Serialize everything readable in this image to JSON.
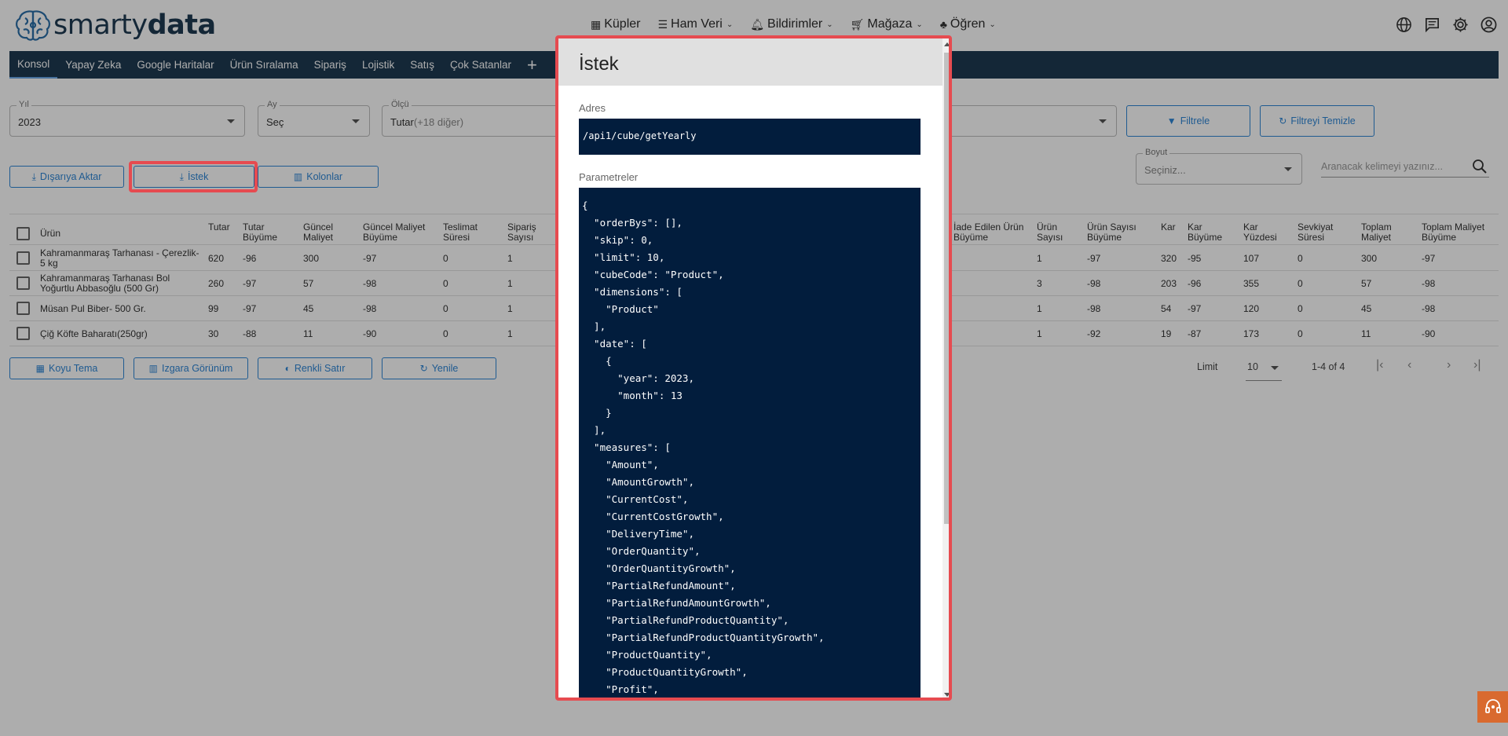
{
  "brand": {
    "name_light": "smarty",
    "name_bold": "data"
  },
  "topnav": [
    {
      "label": "Küpler",
      "icon": "grid-icon",
      "dropdown": false
    },
    {
      "label": "Ham Veri",
      "icon": "list-icon",
      "dropdown": true
    },
    {
      "label": "Bildirimler",
      "icon": "bell-icon",
      "dropdown": true
    },
    {
      "label": "Mağaza",
      "icon": "cart-icon",
      "dropdown": true
    },
    {
      "label": "Öğren",
      "icon": "learn-icon",
      "dropdown": true
    }
  ],
  "tabs": [
    "Konsol",
    "Yapay Zeka",
    "Google Haritalar",
    "Ürün Sıralama",
    "Sipariş",
    "Lojistik",
    "Satış",
    "Çok Satanlar"
  ],
  "filters": {
    "year": {
      "label": "Yıl",
      "value": "2023"
    },
    "month": {
      "label": "Ay",
      "value": "Seç"
    },
    "measure": {
      "label": "Ölçü",
      "value": "Tutar",
      "extra": "(+18 diğer)"
    },
    "filter_button": "Filtrele",
    "clear_button": "Filtreyi Temizle",
    "dimension": {
      "label": "Boyut",
      "placeholder": "Seçiniz..."
    },
    "search_placeholder": "Aranacak kelimeyi yazınız..."
  },
  "actions": {
    "export": "Dışarıya Aktar",
    "request": "İstek",
    "columns": "Kolonlar"
  },
  "table": {
    "left_headers": [
      {
        "l1": "Ürün",
        "l2": ""
      },
      {
        "l1": "Tutar",
        "l2": ""
      },
      {
        "l1": "Tutar",
        "l2": "Büyüme"
      },
      {
        "l1": "Güncel",
        "l2": "Maliyet"
      },
      {
        "l1": "Güncel Maliyet",
        "l2": "Büyüme"
      },
      {
        "l1": "Teslimat",
        "l2": "Süresi"
      },
      {
        "l1": "Sipariş",
        "l2": "Sayısı"
      }
    ],
    "right_headers": [
      {
        "l1": "İade Edilen Ürün",
        "l2": "Büyüme"
      },
      {
        "l1": "Ürün",
        "l2": "Sayısı"
      },
      {
        "l1": "Ürün Sayısı",
        "l2": "Büyüme"
      },
      {
        "l1": "Kar",
        "l2": ""
      },
      {
        "l1": "Kar",
        "l2": "Büyüme"
      },
      {
        "l1": "Kar",
        "l2": "Yüzdesi"
      },
      {
        "l1": "Sevkiyat",
        "l2": "Süresi"
      },
      {
        "l1": "Toplam",
        "l2": "Maliyet"
      },
      {
        "l1": "Toplam Maliyet",
        "l2": "Büyüme"
      }
    ],
    "rows": [
      {
        "product": "Kahramanmaraş Tarhanası - Çerezlik- 5 kg",
        "left": [
          "620",
          "-96",
          "300",
          "-97",
          "0",
          "1"
        ],
        "right": [
          "1",
          "-97",
          "320",
          "-95",
          "107",
          "0",
          "300",
          "-97"
        ]
      },
      {
        "product": "Kahramanmaraş Tarhanası Bol Yoğurtlu Abbasoğlu (500 Gr)",
        "left": [
          "260",
          "-97",
          "57",
          "-98",
          "0",
          "1"
        ],
        "right": [
          "3",
          "-98",
          "203",
          "-96",
          "355",
          "0",
          "57",
          "-98"
        ]
      },
      {
        "product": "Müsan Pul Biber- 500 Gr.",
        "left": [
          "99",
          "-97",
          "45",
          "-98",
          "0",
          "1"
        ],
        "right": [
          "1",
          "-98",
          "54",
          "-97",
          "120",
          "0",
          "45",
          "-98"
        ]
      },
      {
        "product": "Çiğ Köfte Baharatı(250gr)",
        "left": [
          "30",
          "-88",
          "11",
          "-90",
          "0",
          "1"
        ],
        "right": [
          "1",
          "-92",
          "19",
          "-87",
          "173",
          "0",
          "11",
          "-90"
        ]
      }
    ]
  },
  "bottom_buttons": {
    "dark": "Koyu Tema",
    "grid": "Izgara Görünüm",
    "color_row": "Renkli Satır",
    "refresh": "Yenile"
  },
  "pagination": {
    "limit_label": "Limit",
    "limit_value": "10",
    "range": "1-4 of 4"
  },
  "modal": {
    "title": "İstek",
    "address_label": "Adres",
    "address": "/api1/cube/getYearly",
    "params_label": "Parametreler",
    "code": "{\n  \"orderBys\": [],\n  \"skip\": 0,\n  \"limit\": 10,\n  \"cubeCode\": \"Product\",\n  \"dimensions\": [\n    \"Product\"\n  ],\n  \"date\": [\n    {\n      \"year\": 2023,\n      \"month\": 13\n    }\n  ],\n  \"measures\": [\n    \"Amount\",\n    \"AmountGrowth\",\n    \"CurrentCost\",\n    \"CurrentCostGrowth\",\n    \"DeliveryTime\",\n    \"OrderQuantity\",\n    \"OrderQuantityGrowth\",\n    \"PartialRefundAmount\",\n    \"PartialRefundAmountGrowth\",\n    \"PartialRefundProductQuantity\",\n    \"PartialRefundProductQuantityGrowth\",\n    \"ProductQuantity\",\n    \"ProductQuantityGrowth\",\n    \"Profit\","
  },
  "colors": {
    "navy": "#1e3a52",
    "accent": "#2f86d6",
    "highlight": "#e64b50",
    "code_bg": "#021d3d"
  }
}
